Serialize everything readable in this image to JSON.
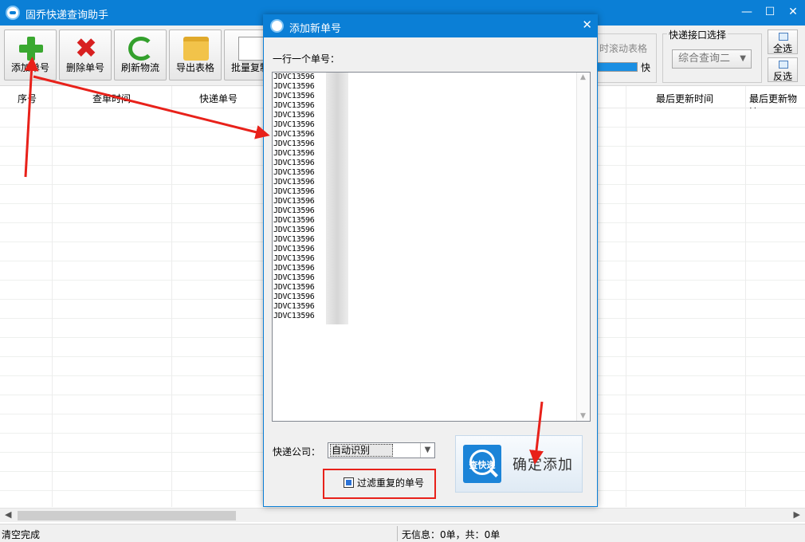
{
  "window": {
    "title": "固乔快递查询助手"
  },
  "toolbar": [
    {
      "label": "添加单号",
      "icon": "plus-icon"
    },
    {
      "label": "删除单号",
      "icon": "x-icon"
    },
    {
      "label": "刷新物流",
      "icon": "refresh-icon"
    },
    {
      "label": "导出表格",
      "icon": "folder-icon"
    },
    {
      "label": "批量复制",
      "icon": "copy-icon"
    }
  ],
  "scroll_group": {
    "label": "时滚动表格",
    "speed_label": "快"
  },
  "api_group": {
    "label": "快递接口选择",
    "selected": "综合查询二"
  },
  "side_buttons": {
    "select_all": "全选",
    "invert": "反选"
  },
  "grid": {
    "columns": [
      "序号",
      "查单时间",
      "快递单号",
      "最后更新时间",
      "最后更新物流"
    ]
  },
  "status": {
    "left": "清空完成",
    "right": "无信息：0单，共：0单"
  },
  "dialog": {
    "title": "添加新单号",
    "lines_label": "一行一个单号：",
    "tracking_numbers": [
      "JDVC13596",
      "JDVC13596",
      "JDVC13596",
      "JDVC13596",
      "JDVC13596",
      "JDVC13596",
      "JDVC13596",
      "JDVC13596",
      "JDVC13596",
      "JDVC13596",
      "JDVC13596",
      "JDVC13596",
      "JDVC13596",
      "JDVC13596",
      "JDVC13596",
      "JDVC13596",
      "JDVC13596",
      "JDVC13596",
      "JDVC13596",
      "JDVC13596",
      "JDVC13596",
      "JDVC13596",
      "JDVC13596",
      "JDVC13596",
      "JDVC13596",
      "JDVC13596"
    ],
    "courier_label": "快递公司：",
    "courier_value": "自动识别",
    "filter_label": "过滤重复的单号",
    "confirm_label": "确定添加",
    "brand_text": "查快递"
  },
  "colors": {
    "titlebar": "#0b7fd6",
    "annotation": "#e8211a"
  }
}
